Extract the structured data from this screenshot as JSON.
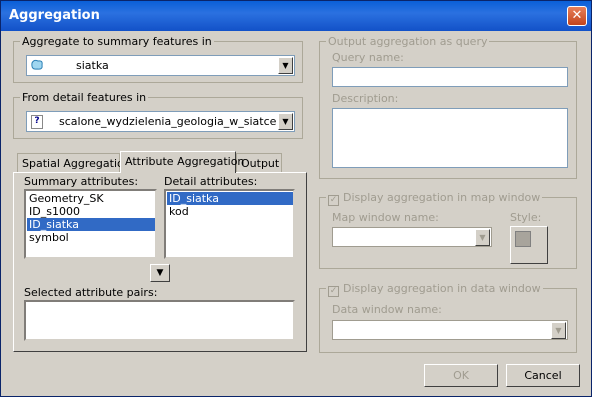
{
  "window": {
    "title": "Aggregation",
    "close_glyph": "✕"
  },
  "aggregate": {
    "group_label": "Aggregate to summary features in",
    "value": "siatka",
    "icon": "polygon-layer-icon",
    "dropdown_glyph": "▼"
  },
  "detail": {
    "group_label": "From detail features in",
    "value": "scalone_wydzielenia_geologia_w_siatce",
    "icon": "unknown-layer-icon",
    "icon_glyph": "?",
    "dropdown_glyph": "▼"
  },
  "tabs": [
    {
      "label": "Spatial Aggregation",
      "active": false
    },
    {
      "label": "Attribute Aggregation",
      "active": true
    },
    {
      "label": "Output",
      "active": false
    }
  ],
  "attributes": {
    "summary_label": "Summary attributes:",
    "summary_items": [
      "Geometry_SK",
      "ID_s1000",
      "ID_siatka",
      "symbol"
    ],
    "summary_selected": 2,
    "detail_label": "Detail attributes:",
    "detail_items": [
      "ID_siatka",
      "kod"
    ],
    "detail_selected": 0,
    "add_pair_glyph": "▼",
    "selected_pairs_label": "Selected attribute pairs:"
  },
  "output_query": {
    "group_label": "Output aggregation as query",
    "query_name_label": "Query name:",
    "description_label": "Description:"
  },
  "map_window": {
    "checkbox_label": "Display aggregation in map window",
    "checked": true,
    "name_label": "Map window name:",
    "style_label": "Style:"
  },
  "data_window": {
    "checkbox_label": "Display aggregation in data window",
    "checked": true,
    "name_label": "Data window name:"
  },
  "buttons": {
    "ok": "OK",
    "cancel": "Cancel"
  },
  "colors": {
    "title_bar": "#0a5fd8",
    "selection": "#316ac5",
    "dialog_bg": "#d4d0c8"
  }
}
